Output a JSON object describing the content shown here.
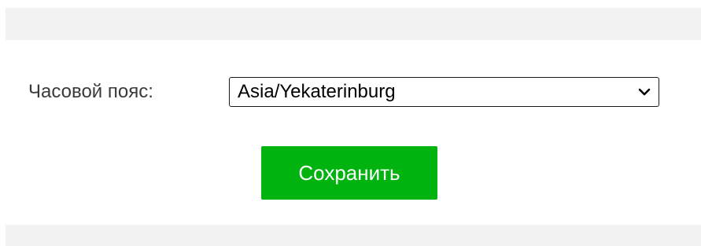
{
  "form": {
    "timezone_label": "Часовой пояс:",
    "timezone_value": "Asia/Yekaterinburg",
    "save_label": "Сохранить"
  },
  "icons": {
    "select_arrow": "chevron-down-icon"
  },
  "colors": {
    "band": "#f2f2f2",
    "save_button": "#00b30f",
    "save_text": "#ffffff",
    "label_text": "#3a3a3a"
  }
}
